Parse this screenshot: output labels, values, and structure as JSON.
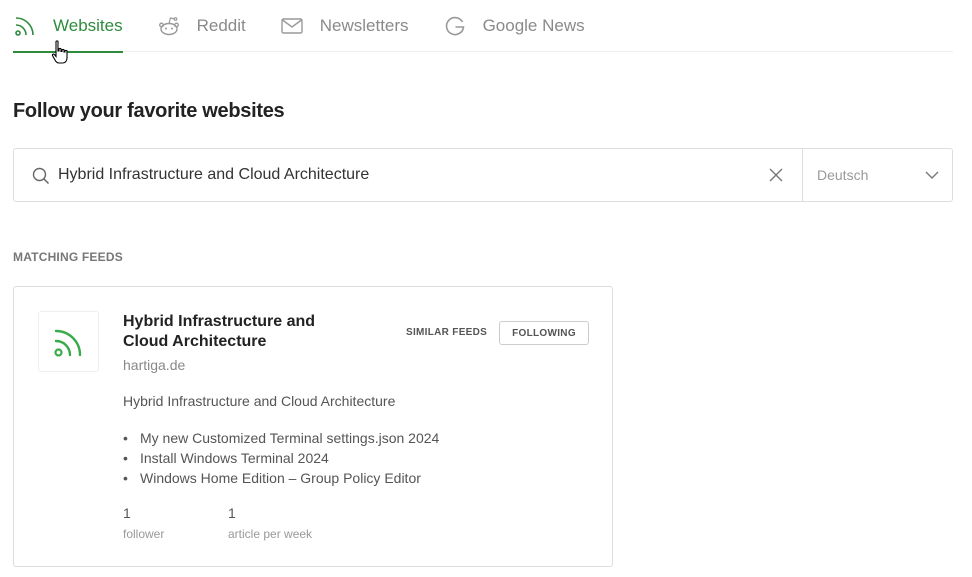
{
  "tabs": [
    {
      "label": "Websites",
      "icon": "rss-icon",
      "active": true
    },
    {
      "label": "Reddit",
      "icon": "reddit-icon",
      "active": false
    },
    {
      "label": "Newsletters",
      "icon": "envelope-icon",
      "active": false
    },
    {
      "label": "Google News",
      "icon": "google-icon",
      "active": false
    }
  ],
  "page": {
    "heading": "Follow your favorite websites"
  },
  "search": {
    "value": "Hybrid Infrastructure and Cloud Architecture",
    "language": "Deutsch"
  },
  "results": {
    "section_label": "MATCHING FEEDS",
    "feed": {
      "title": "Hybrid Infrastructure and Cloud Architecture",
      "domain": "hartiga.de",
      "similar_label": "SIMILAR FEEDS",
      "following_label": "FOLLOWING",
      "description": "Hybrid Infrastructure and Cloud Architecture",
      "articles": [
        "My new Customized Terminal settings.json 2024",
        "Install Windows Terminal 2024",
        "Windows Home Edition – Group Policy Editor"
      ],
      "followers_value": "1",
      "followers_label": "follower",
      "articles_value": "1",
      "articles_label": "article per week"
    }
  },
  "colors": {
    "accent": "#2e8b3e",
    "rss_green": "#3aaa4a",
    "border": "#dddddd"
  }
}
